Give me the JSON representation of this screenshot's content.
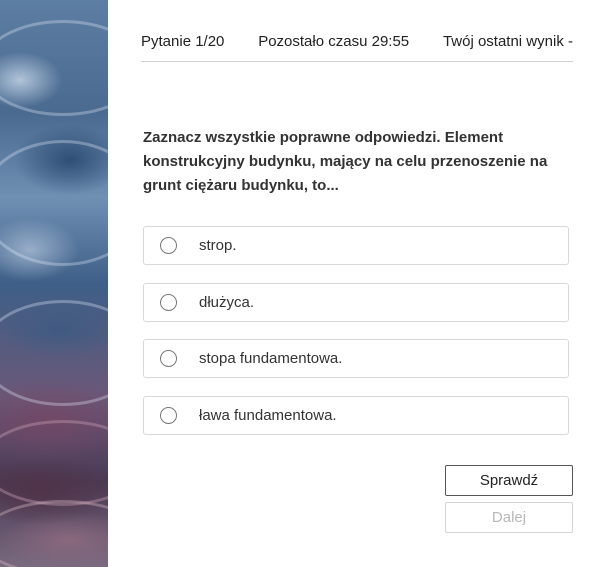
{
  "header": {
    "question_counter": "Pytanie 1/20",
    "time_left": "Pozostało czasu 29:55",
    "last_score": "Twój ostatni wynik -"
  },
  "question": {
    "text": "Zaznacz wszystkie poprawne odpowiedzi. Element konstrukcyjny budynku, mający na celu przenoszenie na grunt ciężaru budynku, to..."
  },
  "options": [
    {
      "label": "strop."
    },
    {
      "label": "dłużyca."
    },
    {
      "label": "stopa fundamentowa."
    },
    {
      "label": "ława fundamentowa."
    }
  ],
  "buttons": {
    "check_label": "Sprawdź",
    "next_label": "Dalej"
  }
}
